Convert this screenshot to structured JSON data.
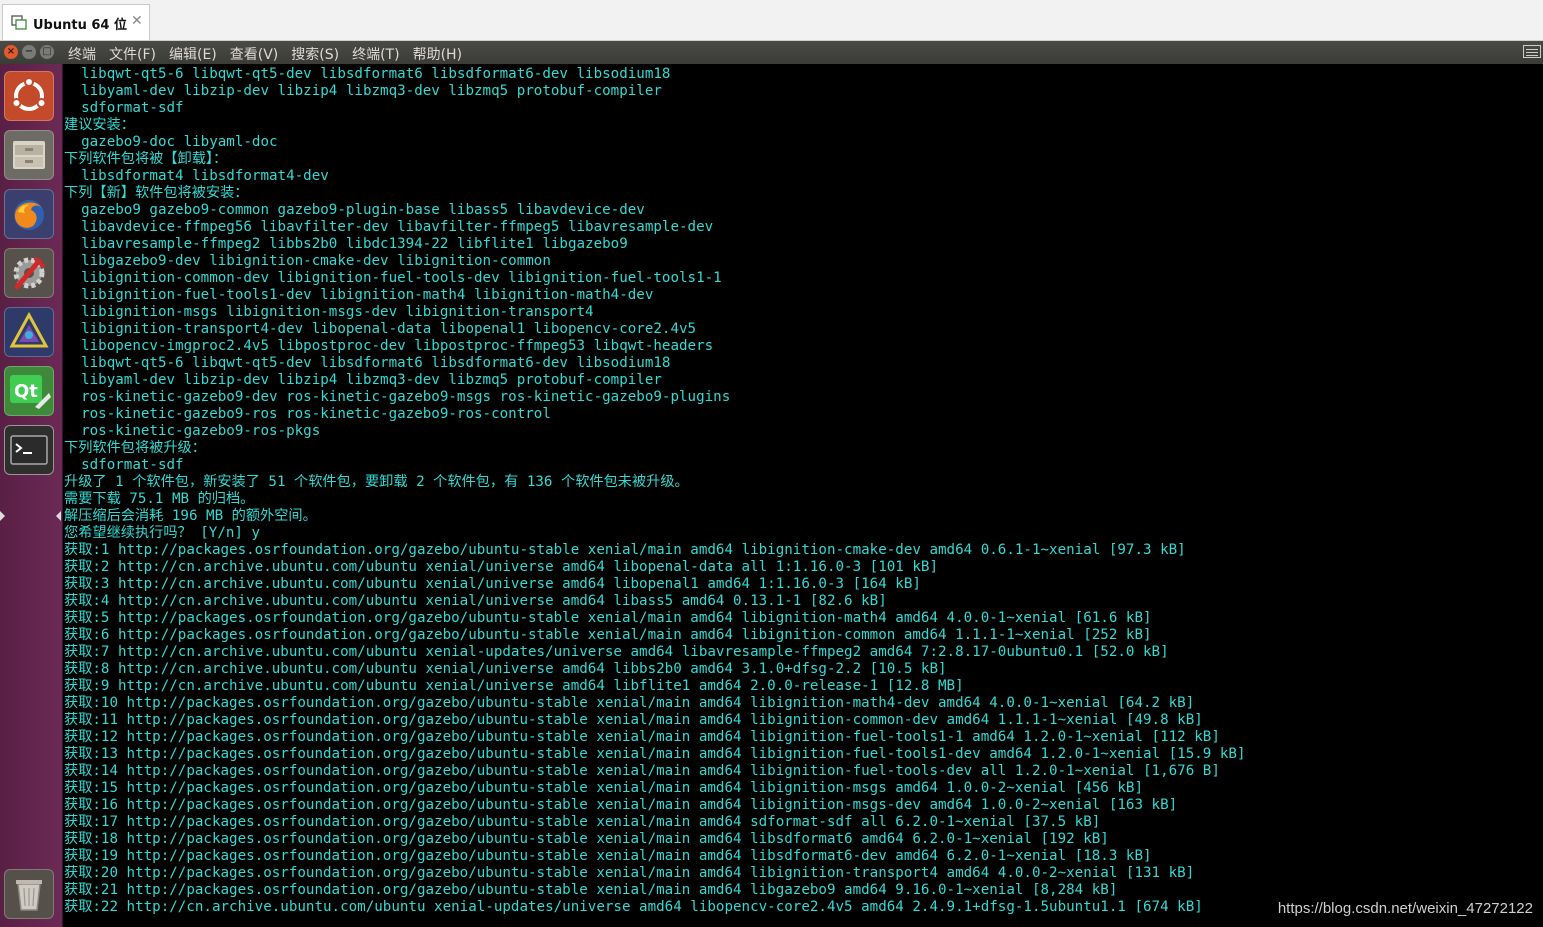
{
  "vm_tab": {
    "title": "Ubuntu 64 位",
    "close": "✕"
  },
  "menubar": {
    "close_symbol": "×",
    "min_symbol": "−",
    "max_symbol": "□",
    "items": [
      "终端",
      "文件(F)",
      "编辑(E)",
      "查看(V)",
      "搜索(S)",
      "终端(T)",
      "帮助(H)"
    ]
  },
  "launcher": {
    "items": [
      {
        "name": "ubuntu-dash-icon",
        "label": "Search your computer"
      },
      {
        "name": "files-icon",
        "label": "Files"
      },
      {
        "name": "firefox-icon",
        "label": "Firefox Web Browser"
      },
      {
        "name": "system-settings-icon",
        "label": "System Settings"
      },
      {
        "name": "rviz-icon",
        "label": "RViz"
      },
      {
        "name": "qt-creator-icon",
        "label": "Qt Creator"
      },
      {
        "name": "terminal-icon",
        "label": "Terminal"
      },
      {
        "name": "trash-icon",
        "label": "Trash"
      }
    ]
  },
  "terminal": {
    "lines": [
      "  libqwt-qt5-6 libqwt-qt5-dev libsdformat6 libsdformat6-dev libsodium18",
      "  libyaml-dev libzip-dev libzip4 libzmq3-dev libzmq5 protobuf-compiler",
      "  sdformat-sdf",
      "建议安装：",
      "  gazebo9-doc libyaml-doc",
      "下列软件包将被【卸载】：",
      "  libsdformat4 libsdformat4-dev",
      "下列【新】软件包将被安装：",
      "  gazebo9 gazebo9-common gazebo9-plugin-base libass5 libavdevice-dev",
      "  libavdevice-ffmpeg56 libavfilter-dev libavfilter-ffmpeg5 libavresample-dev",
      "  libavresample-ffmpeg2 libbs2b0 libdc1394-22 libflite1 libgazebo9",
      "  libgazebo9-dev libignition-cmake-dev libignition-common",
      "  libignition-common-dev libignition-fuel-tools-dev libignition-fuel-tools1-1",
      "  libignition-fuel-tools1-dev libignition-math4 libignition-math4-dev",
      "  libignition-msgs libignition-msgs-dev libignition-transport4",
      "  libignition-transport4-dev libopenal-data libopenal1 libopencv-core2.4v5",
      "  libopencv-imgproc2.4v5 libpostproc-dev libpostproc-ffmpeg53 libqwt-headers",
      "  libqwt-qt5-6 libqwt-qt5-dev libsdformat6 libsdformat6-dev libsodium18",
      "  libyaml-dev libzip-dev libzip4 libzmq3-dev libzmq5 protobuf-compiler",
      "  ros-kinetic-gazebo9-dev ros-kinetic-gazebo9-msgs ros-kinetic-gazebo9-plugins",
      "  ros-kinetic-gazebo9-ros ros-kinetic-gazebo9-ros-control",
      "  ros-kinetic-gazebo9-ros-pkgs",
      "下列软件包将被升级：",
      "  sdformat-sdf",
      "升级了 1 个软件包，新安装了 51 个软件包，要卸载 2 个软件包，有 136 个软件包未被升级。",
      "需要下载 75.1 MB 的归档。",
      "解压缩后会消耗 196 MB 的额外空间。",
      "您希望继续执行吗？ [Y/n] y",
      "获取:1 http://packages.osrfoundation.org/gazebo/ubuntu-stable xenial/main amd64 libignition-cmake-dev amd64 0.6.1-1~xenial [97.3 kB]",
      "获取:2 http://cn.archive.ubuntu.com/ubuntu xenial/universe amd64 libopenal-data all 1:1.16.0-3 [101 kB]",
      "获取:3 http://cn.archive.ubuntu.com/ubuntu xenial/universe amd64 libopenal1 amd64 1:1.16.0-3 [164 kB]",
      "获取:4 http://cn.archive.ubuntu.com/ubuntu xenial/universe amd64 libass5 amd64 0.13.1-1 [82.6 kB]",
      "获取:5 http://packages.osrfoundation.org/gazebo/ubuntu-stable xenial/main amd64 libignition-math4 amd64 4.0.0-1~xenial [61.6 kB]",
      "获取:6 http://packages.osrfoundation.org/gazebo/ubuntu-stable xenial/main amd64 libignition-common amd64 1.1.1-1~xenial [252 kB]",
      "获取:7 http://cn.archive.ubuntu.com/ubuntu xenial-updates/universe amd64 libavresample-ffmpeg2 amd64 7:2.8.17-0ubuntu0.1 [52.0 kB]",
      "获取:8 http://cn.archive.ubuntu.com/ubuntu xenial/universe amd64 libbs2b0 amd64 3.1.0+dfsg-2.2 [10.5 kB]",
      "获取:9 http://cn.archive.ubuntu.com/ubuntu xenial/universe amd64 libflite1 amd64 2.0.0-release-1 [12.8 MB]",
      "获取:10 http://packages.osrfoundation.org/gazebo/ubuntu-stable xenial/main amd64 libignition-math4-dev amd64 4.0.0-1~xenial [64.2 kB]",
      "获取:11 http://packages.osrfoundation.org/gazebo/ubuntu-stable xenial/main amd64 libignition-common-dev amd64 1.1.1-1~xenial [49.8 kB]",
      "获取:12 http://packages.osrfoundation.org/gazebo/ubuntu-stable xenial/main amd64 libignition-fuel-tools1-1 amd64 1.2.0-1~xenial [112 kB]",
      "获取:13 http://packages.osrfoundation.org/gazebo/ubuntu-stable xenial/main amd64 libignition-fuel-tools1-dev amd64 1.2.0-1~xenial [15.9 kB]",
      "获取:14 http://packages.osrfoundation.org/gazebo/ubuntu-stable xenial/main amd64 libignition-fuel-tools-dev all 1.2.0-1~xenial [1,676 B]",
      "获取:15 http://packages.osrfoundation.org/gazebo/ubuntu-stable xenial/main amd64 libignition-msgs amd64 1.0.0-2~xenial [456 kB]",
      "获取:16 http://packages.osrfoundation.org/gazebo/ubuntu-stable xenial/main amd64 libignition-msgs-dev amd64 1.0.0-2~xenial [163 kB]",
      "获取:17 http://packages.osrfoundation.org/gazebo/ubuntu-stable xenial/main amd64 sdformat-sdf all 6.2.0-1~xenial [37.5 kB]",
      "获取:18 http://packages.osrfoundation.org/gazebo/ubuntu-stable xenial/main amd64 libsdformat6 amd64 6.2.0-1~xenial [192 kB]",
      "获取:19 http://packages.osrfoundation.org/gazebo/ubuntu-stable xenial/main amd64 libsdformat6-dev amd64 6.2.0-1~xenial [18.3 kB]",
      "获取:20 http://packages.osrfoundation.org/gazebo/ubuntu-stable xenial/main amd64 libignition-transport4 amd64 4.0.0-2~xenial [131 kB]",
      "获取:21 http://packages.osrfoundation.org/gazebo/ubuntu-stable xenial/main amd64 libgazebo9 amd64 9.16.0-1~xenial [8,284 kB]",
      "获取:22 http://cn.archive.ubuntu.com/ubuntu xenial-updates/universe amd64 libopencv-core2.4v5 amd64 2.4.9.1+dfsg-1.5ubuntu1.1 [674 kB]"
    ]
  },
  "watermark": "https://blog.csdn.net/weixin_47272122",
  "colors": {
    "terminal_text": "#33d9d2",
    "terminal_bg": "#000000",
    "launcher_bg": "#5a1f45",
    "menubar_bg": "#3c3b37"
  }
}
